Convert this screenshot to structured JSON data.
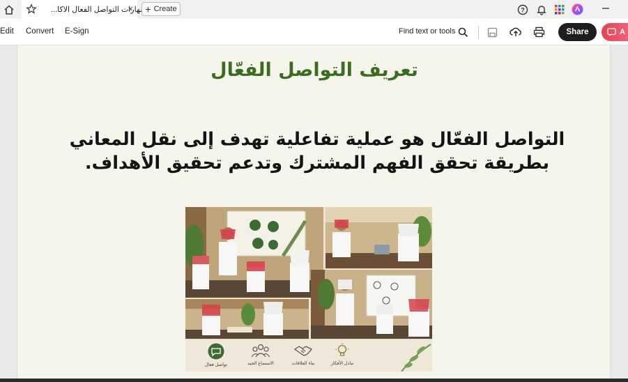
{
  "tabbar": {
    "tab_title": "مهارات التواصل الفعال الاكا...",
    "create_label": "Create"
  },
  "toolbar": {
    "menu": [
      "Edit",
      "Convert",
      "E-Sign"
    ],
    "find_label": "Find text or tools",
    "share_label": "Share",
    "ai_label": "A"
  },
  "slide": {
    "title": "تعريف التواصل الفعّال",
    "body": "التواصل الفعّال هو عملية تفاعلية تهدف إلى نقل المعاني بطريقة تحقق الفهم المشترك وتدعم تحقيق الأهداف.",
    "icons": [
      {
        "label": "تبادل الأفكار",
        "icon": "lightbulb-icon"
      },
      {
        "label": "بناء العلاقات",
        "icon": "handshake-icon"
      },
      {
        "label": "الاستماع الجيد",
        "icon": "people-icon"
      },
      {
        "label": "تواصل فعال",
        "icon": "chat-bubble-icon"
      }
    ]
  },
  "colors": {
    "title_green": "#3a6d1f",
    "page_bg": "#f5f5ec",
    "share_bg": "#1e1e1e",
    "ai_gradient": "#e8424f"
  }
}
